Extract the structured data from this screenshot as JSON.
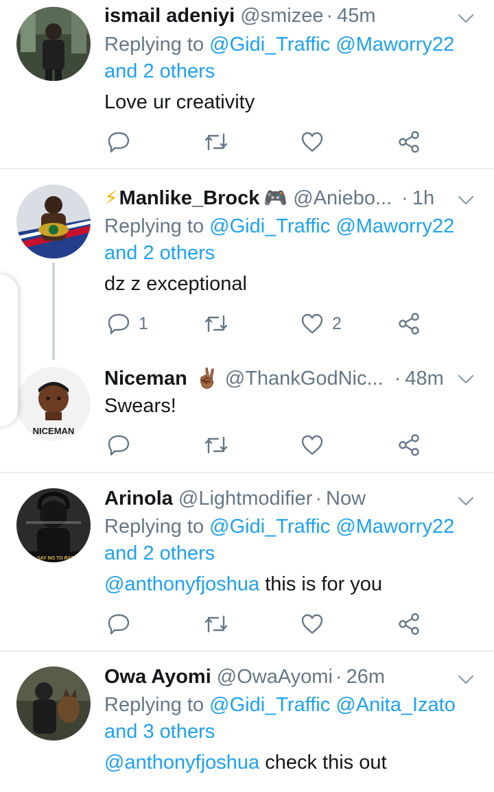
{
  "tweets": [
    {
      "display_name": "ismail adeniyi",
      "handle": "@smizee",
      "separator": "·",
      "time": "45m",
      "replying_to_label": "Replying to",
      "mention_1": "@Gidi_Traffic",
      "mention_2": "@Maworry22",
      "others": "and 2 others",
      "text": "Love ur creativity"
    },
    {
      "emoji_prefix": "⚡",
      "display_name": "Manlike_Brock",
      "emoji_suffix": "🎮",
      "handle": "@Aniebo...",
      "separator": "·",
      "time": "1h",
      "replying_to_label": "Replying to",
      "mention_1": "@Gidi_Traffic",
      "mention_2": "@Maworry22",
      "others": "and 2 others",
      "text": "dz z exceptional",
      "reply_count": "1",
      "like_count": "2"
    },
    {
      "display_name": "Niceman",
      "emoji_suffix": "✌🏾",
      "handle": "@ThankGodNic...",
      "separator": "·",
      "time": "48m",
      "text": "Swears!",
      "avatar_caption": "NICEMAN"
    },
    {
      "display_name": "Arinola",
      "handle": "@Lightmodifier",
      "separator": "·",
      "time": "Now",
      "replying_to_label": "Replying to",
      "mention_1": "@Gidi_Traffic",
      "mention_2": "@Maworry22",
      "others": "and 2 others",
      "text_mention": "@anthonyfjoshua",
      "text": "this is for you",
      "avatar_caption": "SAY NO TO RAPE"
    },
    {
      "display_name": "Owa Ayomi",
      "handle": "@OwaAyomi",
      "separator": "·",
      "time": "26m",
      "replying_to_label": "Replying to",
      "mention_1": "@Gidi_Traffic",
      "mention_2": "@Anita_Izato",
      "others": "and 3 others",
      "text_mention": "@anthonyfjoshua",
      "text": "check this out"
    }
  ],
  "icons": {
    "reply": "reply-icon",
    "retweet": "retweet-icon",
    "like": "heart-icon",
    "share": "share-icon",
    "more": "chevron-down-icon"
  },
  "colors": {
    "link": "#1da1f2",
    "secondary_text": "#657786",
    "primary_text": "#14171a",
    "divider": "#e6ecf0",
    "thread_line": "#ccd6dd"
  }
}
